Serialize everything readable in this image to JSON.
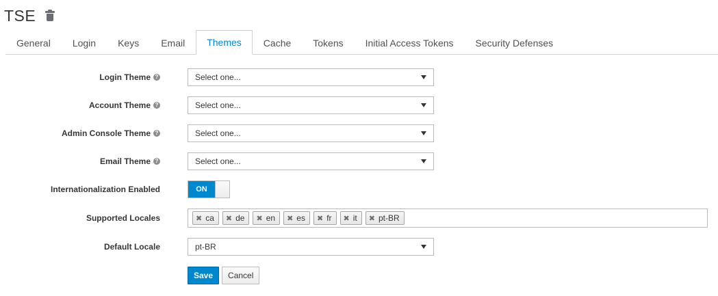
{
  "realm": {
    "title": "TSE"
  },
  "tabs": [
    {
      "label": "General"
    },
    {
      "label": "Login"
    },
    {
      "label": "Keys"
    },
    {
      "label": "Email"
    },
    {
      "label": "Themes",
      "active": true
    },
    {
      "label": "Cache"
    },
    {
      "label": "Tokens"
    },
    {
      "label": "Initial Access Tokens"
    },
    {
      "label": "Security Defenses"
    }
  ],
  "form": {
    "login_theme": {
      "label": "Login Theme",
      "value": "Select one..."
    },
    "account_theme": {
      "label": "Account Theme",
      "value": "Select one..."
    },
    "admin_console_theme": {
      "label": "Admin Console Theme",
      "value": "Select one..."
    },
    "email_theme": {
      "label": "Email Theme",
      "value": "Select one..."
    },
    "i18n": {
      "label": "Internationalization Enabled",
      "state": "ON"
    },
    "supported_locales": {
      "label": "Supported Locales",
      "tags": [
        "ca",
        "de",
        "en",
        "es",
        "fr",
        "it",
        "pt-BR"
      ]
    },
    "default_locale": {
      "label": "Default Locale",
      "value": "pt-BR"
    }
  },
  "buttons": {
    "save": "Save",
    "cancel": "Cancel"
  },
  "icons": {
    "help": "question-circle-icon",
    "delete": "trash-icon",
    "remove_tag": "times-icon"
  },
  "colors": {
    "accent": "#0088ce",
    "text": "#363636"
  }
}
